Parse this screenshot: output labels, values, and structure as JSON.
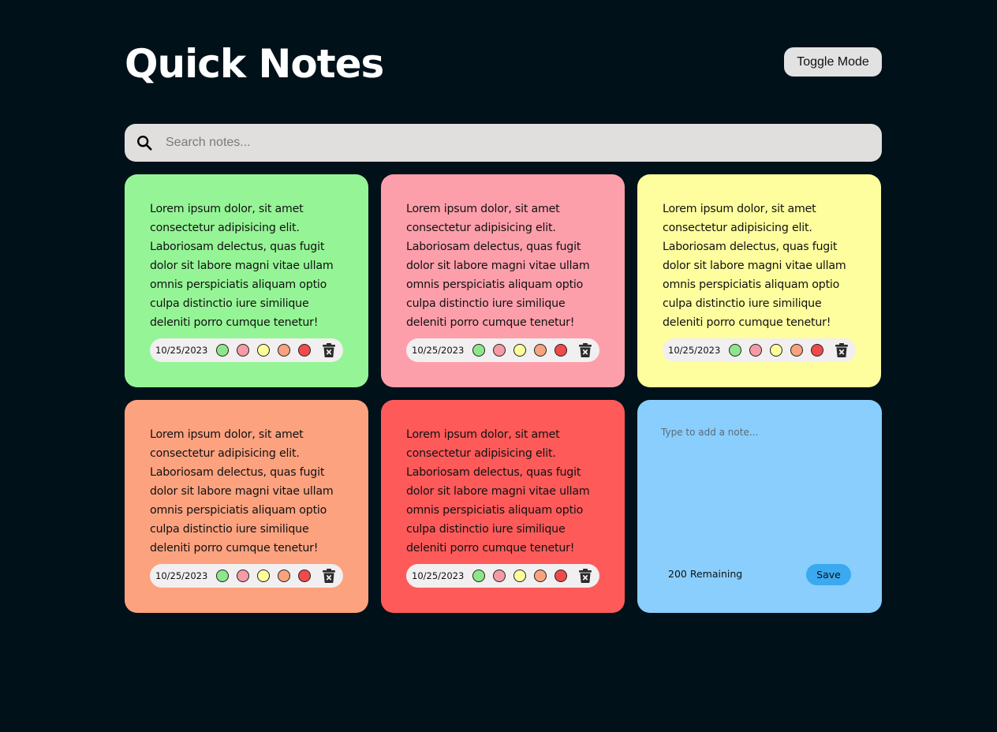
{
  "header": {
    "title": "Quick Notes",
    "toggle_label": "Toggle Mode"
  },
  "search": {
    "placeholder": "Search notes...",
    "icon": "search-icon"
  },
  "swatch_colors": [
    "#8ee68a",
    "#f49ba6",
    "#fdfd9a",
    "#f8a27e",
    "#f04a4a"
  ],
  "notes": [
    {
      "text": "Lorem ipsum dolor, sit amet consectetur adipisicing elit. Laboriosam delectus, quas fugit dolor sit labore magni vitae ullam omnis perspiciatis aliquam optio culpa distinctio iure similique deleniti porro cumque tenetur!",
      "date": "10/25/2023",
      "color": "#95f596"
    },
    {
      "text": "Lorem ipsum dolor, sit amet consectetur adipisicing elit. Laboriosam delectus, quas fugit dolor sit labore magni vitae ullam omnis perspiciatis aliquam optio culpa distinctio iure similique deleniti porro cumque tenetur!",
      "date": "10/25/2023",
      "color": "#fd9fab"
    },
    {
      "text": "Lorem ipsum dolor, sit amet consectetur adipisicing elit. Laboriosam delectus, quas fugit dolor sit labore magni vitae ullam omnis perspiciatis aliquam optio culpa distinctio iure similique deleniti porro cumque tenetur!",
      "date": "10/25/2023",
      "color": "#fefe9e"
    },
    {
      "text": "Lorem ipsum dolor, sit amet consectetur adipisicing elit. Laboriosam delectus, quas fugit dolor sit labore magni vitae ullam omnis perspiciatis aliquam optio culpa distinctio iure similique deleniti porro cumque tenetur!",
      "date": "10/25/2023",
      "color": "#fca27f"
    },
    {
      "text": "Lorem ipsum dolor, sit amet consectetur adipisicing elit. Laboriosam delectus, quas fugit dolor sit labore magni vitae ullam omnis perspiciatis aliquam optio culpa distinctio iure similique deleniti porro cumque tenetur!",
      "date": "10/25/2023",
      "color": "#fe5a5a"
    }
  ],
  "add_note": {
    "placeholder": "Type to add a note...",
    "remaining": "200 Remaining",
    "save_label": "Save",
    "color": "#89cefc"
  },
  "icons": {
    "delete": "trash-icon"
  }
}
